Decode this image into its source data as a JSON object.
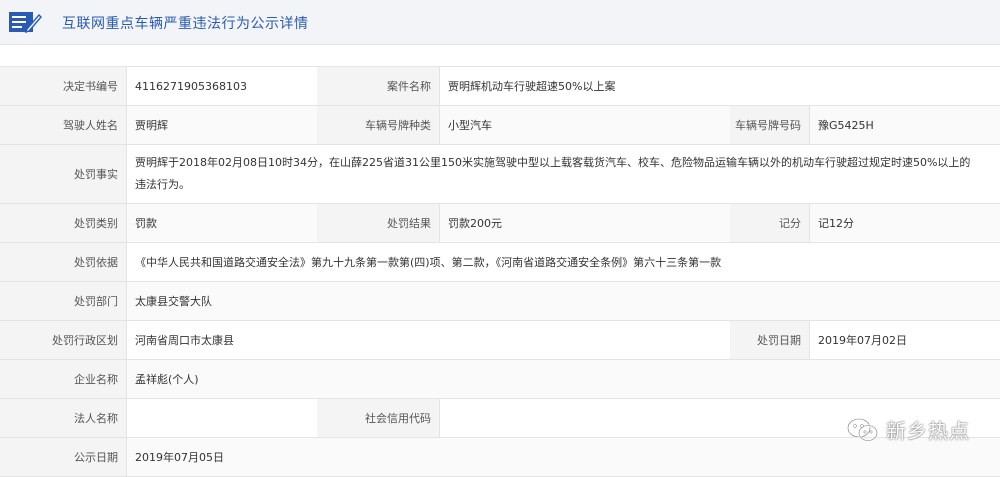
{
  "header": {
    "title": "互联网重点车辆严重违法行为公示详情",
    "icon": "document-edit-icon"
  },
  "fields": {
    "decision_no": {
      "label": "决定书编号",
      "value": "4116271905368103"
    },
    "case_name": {
      "label": "案件名称",
      "value": "贾明辉机动车行驶超速50%以上案"
    },
    "driver_name": {
      "label": "驾驶人姓名",
      "value": "贾明辉"
    },
    "plate_type": {
      "label": "车辆号牌种类",
      "value": "小型汽车"
    },
    "plate_no": {
      "label": "车辆号牌号码",
      "value": "豫G5425H"
    },
    "facts": {
      "label": "处罚事实",
      "value": "贾明辉于2018年02月08日10时34分，在山薛225省道31公里150米实施驾驶中型以上载客载货汽车、校车、危险物品运输车辆以外的机动车行驶超过规定时速50%以上的违法行为。"
    },
    "penalty_type": {
      "label": "处罚类别",
      "value": "罚款"
    },
    "penalty_result": {
      "label": "处罚结果",
      "value": "罚款200元"
    },
    "points": {
      "label": "记分",
      "value": "记12分"
    },
    "basis": {
      "label": "处罚依据",
      "value": "《中华人民共和国道路交通安全法》第九十九条第一款第(四)项、第二款，《河南省道路交通安全条例》第六十三条第一款"
    },
    "department": {
      "label": "处罚部门",
      "value": "太康县交警大队"
    },
    "region": {
      "label": "处罚行政区划",
      "value": "河南省周口市太康县"
    },
    "penalty_date": {
      "label": "处罚日期",
      "value": "2019年07月02日"
    },
    "company": {
      "label": "企业名称",
      "value": "孟祥彪(个人)"
    },
    "legal_person": {
      "label": "法人名称",
      "value": ""
    },
    "credit_code": {
      "label": "社会信用代码",
      "value": ""
    },
    "publish_date": {
      "label": "公示日期",
      "value": "2019年07月05日"
    }
  },
  "watermark": {
    "text": "新乡热点",
    "icon": "wechat-icon"
  },
  "colors": {
    "title": "#2a5bb4",
    "label_bg": "#f4f4f4",
    "border": "#e4e4e4",
    "header_bg": "#f2f4f7"
  }
}
